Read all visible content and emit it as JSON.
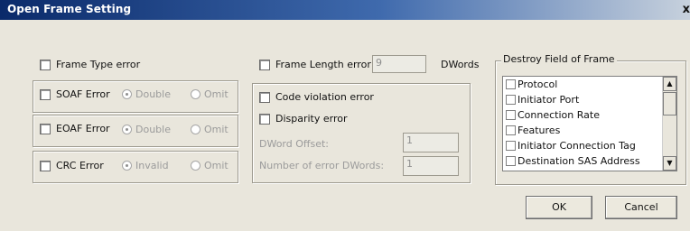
{
  "window": {
    "title": "Open Frame Setting",
    "close_symbol": "x"
  },
  "left": {
    "frame_type_label": "Frame Type error",
    "soaf": {
      "label": "SOAF Error",
      "opt1": "Double",
      "opt2": "Omit"
    },
    "eoaf": {
      "label": "EOAF Error",
      "opt1": "Double",
      "opt2": "Omit"
    },
    "crc": {
      "label": "CRC Error",
      "opt1": "Invalid",
      "opt2": "Omit"
    }
  },
  "middle": {
    "frame_length_label": "Frame Length error",
    "frame_length_value": "9",
    "dwords_unit": "DWords",
    "code_violation_label": "Code violation error",
    "disparity_label": "Disparity error",
    "dword_offset_label": "DWord Offset:",
    "dword_offset_value": "1",
    "num_error_dwords_label": "Number of error DWords:",
    "num_error_dwords_value": "1"
  },
  "destroy_field": {
    "title": "Destroy Field of Frame",
    "items": [
      "Protocol",
      "Initiator Port",
      "Connection Rate",
      "Features",
      "Initiator Connection Tag",
      "Destination SAS Address"
    ]
  },
  "buttons": {
    "ok": "OK",
    "cancel": "Cancel"
  }
}
